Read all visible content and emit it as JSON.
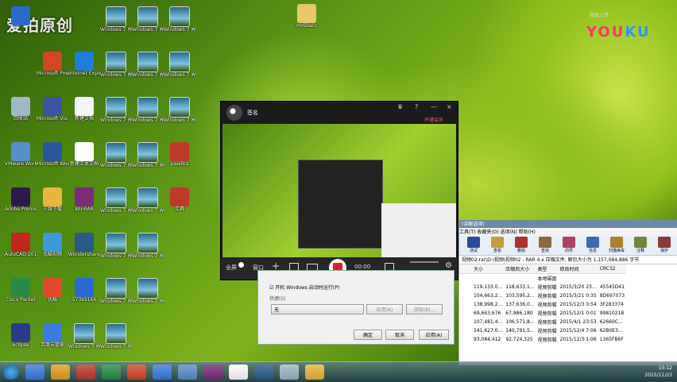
{
  "watermark": "爱拍原创",
  "youku": {
    "badge": "我知上传",
    "y1": "YOU",
    "y2": "KU"
  },
  "desktop_icons": [
    {
      "label": "",
      "color": "#2a6ad0",
      "type": "app"
    },
    {
      "label": "Windows 7 界面主题壁纸",
      "type": "vid"
    },
    {
      "label": "Windows 7 界面主题壁纸",
      "type": "vid"
    },
    {
      "label": "Windows 7 界面主题壁纸",
      "type": "vid"
    },
    {
      "label": "Microsoft PowerPoint",
      "color": "#d24726",
      "type": "app"
    },
    {
      "label": "Internet Explorer",
      "color": "#1e7fd8",
      "type": "app"
    },
    {
      "label": "Windows 7 界面主题壁纸",
      "type": "vid"
    },
    {
      "label": "Windows 7 界面主题壁纸",
      "type": "vid"
    },
    {
      "label": "Windows 7 界面主题壁纸",
      "type": "vid"
    },
    {
      "label": "回收站",
      "color": "#9fb8c8",
      "type": "app"
    },
    {
      "label": "Microsoft Visio 2010",
      "color": "#3955a3",
      "type": "app"
    },
    {
      "label": "新建文档",
      "color": "#f5f5f5",
      "type": "app"
    },
    {
      "label": "Windows 7 界面主题壁纸",
      "type": "vid"
    },
    {
      "label": "Windows 7 界面主题壁纸",
      "type": "vid"
    },
    {
      "label": "Windows 7 界面主题壁纸",
      "type": "vid"
    },
    {
      "label": "VMware Workstation",
      "color": "#5a8ec8",
      "type": "app"
    },
    {
      "label": "Microsoft Word 2010",
      "color": "#2b579a",
      "type": "app"
    },
    {
      "label": "新建文本文档",
      "color": "#fff",
      "type": "app"
    },
    {
      "label": "Windows 7 界面主题壁纸",
      "type": "vid"
    },
    {
      "label": "Windows 7 界面主题壁纸",
      "type": "vid"
    },
    {
      "label": "paiallcs",
      "color": "#c0392b",
      "type": "app"
    },
    {
      "label": "Adobe Premiere",
      "color": "#2c1a4e",
      "type": "app"
    },
    {
      "label": "三维下载",
      "color": "#e8b63a",
      "type": "app"
    },
    {
      "label": "WinRAR",
      "color": "#7a2b7a",
      "type": "app"
    },
    {
      "label": "Windows 7 界面主题壁纸",
      "type": "vid"
    },
    {
      "label": "Windows 7 界面主题壁纸",
      "type": "vid"
    },
    {
      "label": "工具",
      "color": "#c0392b",
      "type": "app"
    },
    {
      "label": "AutoCAD 2010",
      "color": "#c0281e",
      "type": "app"
    },
    {
      "label": "优酷视频",
      "color": "#3a9bd8",
      "type": "app"
    },
    {
      "label": "Wondershare Video Editor",
      "color": "#2a5a8a",
      "type": "app"
    },
    {
      "label": "Windows 7 界面主题壁纸",
      "type": "vid"
    },
    {
      "label": "Windows 7 界面主题壁纸",
      "type": "vid"
    },
    {
      "label": "Cisco Packet",
      "color": "#2a8a4a",
      "type": "app"
    },
    {
      "label": "优酷",
      "color": "#e04a2a",
      "type": "app"
    },
    {
      "label": "573x5166",
      "color": "#2a6ad0",
      "type": "app"
    },
    {
      "label": "Windows 7 界面主题壁纸",
      "type": "vid"
    },
    {
      "label": "Windows 7 界面主题壁纸",
      "type": "vid"
    },
    {
      "label": "eclipse",
      "color": "#2b3a8a",
      "type": "app"
    },
    {
      "label": "百度云管家",
      "color": "#3a7be0",
      "type": "app"
    },
    {
      "label": "Windows 7 界面主题壁纸",
      "type": "vid"
    },
    {
      "label": "Windows 7 界面主题壁纸",
      "type": "vid"
    },
    {
      "label": "HoSbacc",
      "color": "#e8d8a0",
      "type": "app"
    }
  ],
  "recorder": {
    "username": "签名",
    "upgrade": "开通会员",
    "title_buttons": [
      "?",
      "—",
      "×"
    ],
    "controls": {
      "fullscreen": "全屏",
      "window": "窗口",
      "time": "00:00"
    }
  },
  "dialog": {
    "checkbox": "开机 Windows 启动时运行(P)",
    "group": "热键(S)",
    "select": "无",
    "btn_apply": "应用(A)",
    "btn_browse": "浏览(B)...",
    "ok": "确定",
    "cancel": "取消",
    "apply": "应用(A)"
  },
  "rar": {
    "menu": "工具(T) 收藏夹(O) 选项(N) 帮助(H)",
    "title_strip": "(讲解选项)",
    "toolbar": [
      "测试",
      "查看",
      "删除",
      "查找",
      "向导",
      "信息",
      "扫描病毒",
      "注释",
      "保护"
    ],
    "path": "视频02.rar\\D:\\视频\\视频02 - RAR 4.x 压缩文件, 解包大小为 1,157,084,886 字节",
    "headers": [
      "大小",
      "压缩后大小",
      "类型",
      "修改时间",
      "CRC32"
    ],
    "rows": [
      [
        "",
        "",
        "本地磁盘",
        "",
        ""
      ],
      [
        "119,133,0...",
        "118,633,1...",
        "视频剪辑",
        "2015/3/20 23...",
        "45545D41"
      ],
      [
        "104,663,2...",
        "103,595,2...",
        "视频剪辑",
        "2015/3/21 0:35",
        "8D697073"
      ],
      [
        "138,998,2...",
        "137,636,0...",
        "视频剪辑",
        "2015/12/3 0:54",
        "3F283374"
      ],
      [
        "69,663,676",
        "67,986,180",
        "视频剪辑",
        "2015/12/1 0:01",
        "99810218"
      ],
      [
        "107,481,4...",
        "106,571,8...",
        "视频剪辑",
        "2015/4/1 23:53",
        "62660C..."
      ],
      [
        "141,627,0...",
        "140,791,5...",
        "视频剪辑",
        "2015/12/4 7:06",
        "62B0E3..."
      ],
      [
        "93,084,412",
        "92,724,325",
        "视频剪辑",
        "2015/12/3 1:06",
        "1365FB6F"
      ]
    ],
    "left_names": [
      "神制所用年度备...",
      "神制播放MV 20..."
    ]
  },
  "clock": {
    "time": "10:12",
    "date": "2015/11/23"
  }
}
